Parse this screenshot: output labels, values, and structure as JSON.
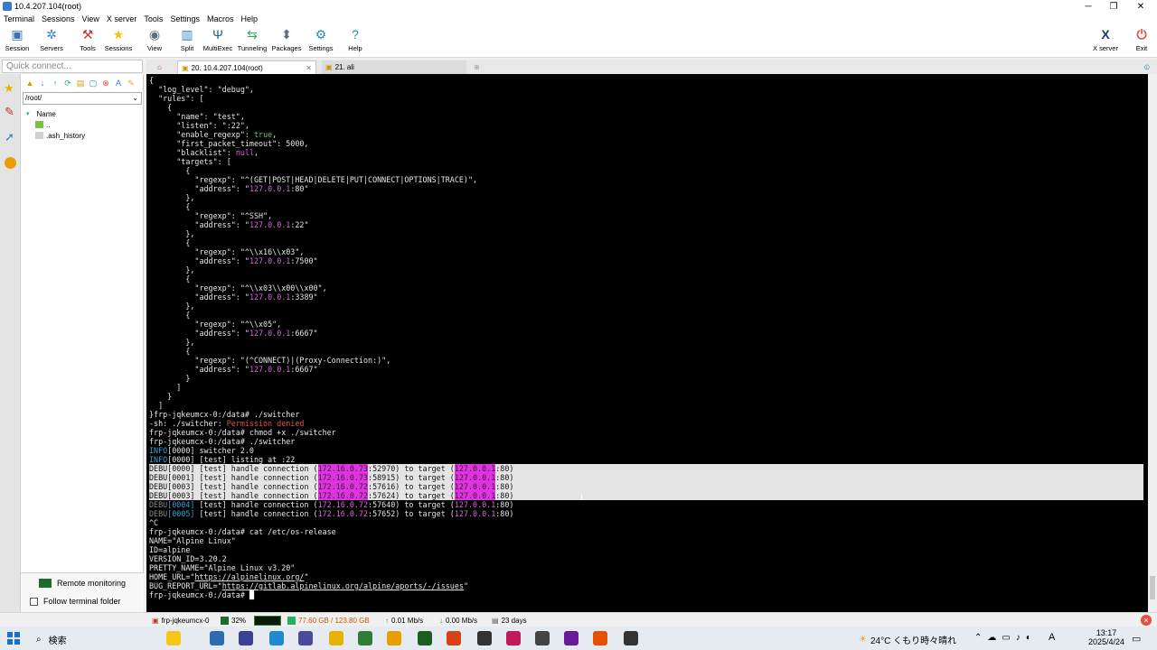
{
  "window": {
    "title": "10.4.207.104(root)",
    "controls": [
      "─",
      "❐",
      "✕"
    ]
  },
  "menu": [
    "Terminal",
    "Sessions",
    "View",
    "X server",
    "Tools",
    "Settings",
    "Macros",
    "Help"
  ],
  "toolbar": [
    {
      "label": "Session",
      "icon": "session-icon",
      "color": "#3b6fb6"
    },
    {
      "label": "Servers",
      "icon": "servers-icon",
      "color": "#2e86c1"
    },
    {
      "label": "Tools",
      "icon": "tools-icon",
      "color": "#c0392b"
    },
    {
      "label": "Sessions",
      "icon": "star-icon",
      "color": "#f1c40f"
    },
    {
      "label": "View",
      "icon": "view-icon",
      "color": "#5d6d7e"
    },
    {
      "label": "Split",
      "icon": "split-icon",
      "color": "#2e86c1"
    },
    {
      "label": "MultiExec",
      "icon": "multiexec-icon",
      "color": "#1f618d"
    },
    {
      "label": "Tunneling",
      "icon": "tunneling-icon",
      "color": "#27ae60"
    },
    {
      "label": "Packages",
      "icon": "packages-icon",
      "color": "#5d6d7e"
    },
    {
      "label": "Settings",
      "icon": "gear-icon",
      "color": "#2e86c1"
    },
    {
      "label": "Help",
      "icon": "help-icon",
      "color": "#2e86c1"
    }
  ],
  "toolbar_right": [
    {
      "label": "X server",
      "icon": "x-server-icon"
    },
    {
      "label": "Exit",
      "icon": "exit-icon"
    }
  ],
  "quick_connect": {
    "placeholder": "Quick connect..."
  },
  "tabs": [
    {
      "label": "20. 10.4.207.104(root)",
      "active": true
    },
    {
      "label": "21. ali",
      "active": false
    }
  ],
  "filepane": {
    "path": "/root/",
    "column": "Name",
    "items": [
      "..",
      ".ash_history"
    ],
    "remote_monitoring": "Remote monitoring",
    "follow_folder": "Follow terminal folder"
  },
  "terminal": {
    "lines": [
      [
        {
          "t": "{"
        }
      ],
      [
        {
          "t": "  \"log_level\": \"debug\","
        }
      ],
      [
        {
          "t": "  \"rules\": ["
        }
      ],
      [
        {
          "t": "    {"
        }
      ],
      [
        {
          "t": "      \"name\": \"test\","
        }
      ],
      [
        {
          "t": "      \"listen\": \":22\","
        }
      ],
      [
        {
          "t": "      \"enable_regexp\": "
        },
        {
          "t": "true",
          "c": "#7ec640"
        },
        {
          "t": ","
        }
      ],
      [
        {
          "t": "      \"first_packet_timeout\": 5000,"
        }
      ],
      [
        {
          "t": "      \"blacklist\": "
        },
        {
          "t": "null",
          "c": "#d56ad5"
        },
        {
          "t": ","
        }
      ],
      [
        {
          "t": "      \"targets\": ["
        }
      ],
      [
        {
          "t": "        {"
        }
      ],
      [
        {
          "t": "          \"regexp\": \"^(GET|POST|HEAD|DELETE|PUT|CONNECT|OPTIONS|TRACE)\","
        }
      ],
      [
        {
          "t": "          \"address\": \""
        },
        {
          "t": "127.0.0.1",
          "c": "#d56ad5"
        },
        {
          "t": ":80\""
        }
      ],
      [
        {
          "t": "        },"
        }
      ],
      [
        {
          "t": "        {"
        }
      ],
      [
        {
          "t": "          \"regexp\": \"^SSH\","
        }
      ],
      [
        {
          "t": "          \"address\": \""
        },
        {
          "t": "127.0.0.1",
          "c": "#d56ad5"
        },
        {
          "t": ":22\""
        }
      ],
      [
        {
          "t": "        },"
        }
      ],
      [
        {
          "t": "        {"
        }
      ],
      [
        {
          "t": "          \"regexp\": \"^\\\\x16\\\\x03\","
        }
      ],
      [
        {
          "t": "          \"address\": \""
        },
        {
          "t": "127.0.0.1",
          "c": "#d56ad5"
        },
        {
          "t": ":7500\""
        }
      ],
      [
        {
          "t": "        },"
        }
      ],
      [
        {
          "t": "        {"
        }
      ],
      [
        {
          "t": "          \"regexp\": \"^\\\\x03\\\\x00\\\\x00\","
        }
      ],
      [
        {
          "t": "          \"address\": \""
        },
        {
          "t": "127.0.0.1",
          "c": "#d56ad5"
        },
        {
          "t": ":3389\""
        }
      ],
      [
        {
          "t": "        },"
        }
      ],
      [
        {
          "t": "        {"
        }
      ],
      [
        {
          "t": "          \"regexp\": \"^\\\\x05\","
        }
      ],
      [
        {
          "t": "          \"address\": \""
        },
        {
          "t": "127.0.0.1",
          "c": "#d56ad5"
        },
        {
          "t": ":6667\""
        }
      ],
      [
        {
          "t": "        },"
        }
      ],
      [
        {
          "t": "        {"
        }
      ],
      [
        {
          "t": "          \"regexp\": \"(^CONNECT)|(Proxy-Connection:)\","
        }
      ],
      [
        {
          "t": "          \"address\": \""
        },
        {
          "t": "127.0.0.1",
          "c": "#d56ad5"
        },
        {
          "t": ":6667\""
        }
      ],
      [
        {
          "t": "        }"
        }
      ],
      [
        {
          "t": "      ]"
        }
      ],
      [
        {
          "t": "    }"
        }
      ],
      [
        {
          "t": "  ]"
        }
      ],
      [
        {
          "t": "}frp-jqkeumcx-0:/data# ./switcher"
        }
      ],
      [
        {
          "t": "-sh: ./switcher: "
        },
        {
          "t": "Permission denied",
          "c": "#e05050"
        }
      ],
      [
        {
          "t": "frp-jqkeumcx-0:/data# chmod +x ./switcher"
        }
      ],
      [
        {
          "t": "frp-jqkeumcx-0:/data# ./switcher"
        }
      ],
      [
        {
          "t": "INFO",
          "c": "#3aa0d8"
        },
        {
          "t": "[0000] switcher 2.0"
        }
      ],
      [
        {
          "t": "INFO",
          "c": "#3aa0d8"
        },
        {
          "t": "[0000] [test] listing at :22"
        }
      ],
      [
        {
          "t": "DEBU",
          "c": "#888888"
        },
        {
          "t": "[0000]",
          "c": "#3aa0d8"
        },
        {
          "t": " [test] handle connection ("
        },
        {
          "t": "172.16.0.73",
          "c": "#d56ad5"
        },
        {
          "t": ":52970) to target ("
        },
        {
          "t": "127.0.0.1",
          "c": "#d56ad5"
        },
        {
          "t": ":80)"
        }
      ],
      [
        {
          "t": "DEBU",
          "c": "#888888"
        },
        {
          "t": "[0001]",
          "c": "#3aa0d8"
        },
        {
          "t": " [test] handle connection ("
        },
        {
          "t": "172.16.0.73",
          "c": "#d56ad5"
        },
        {
          "t": ":58915) to target ("
        },
        {
          "t": "127.0.0.1",
          "c": "#d56ad5"
        },
        {
          "t": ":80)"
        }
      ],
      [
        {
          "t": "DEBU",
          "c": "#888888"
        },
        {
          "t": "[0003]",
          "c": "#3aa0d8"
        },
        {
          "t": " [test] handle connection ("
        },
        {
          "t": "172.16.0.72",
          "c": "#d56ad5"
        },
        {
          "t": ":57616) to target ("
        },
        {
          "t": "127.0.0.1",
          "c": "#d56ad5"
        },
        {
          "t": ":80)"
        }
      ],
      [
        {
          "t": "DEBU",
          "c": "#888888"
        },
        {
          "t": "[0003]",
          "c": "#3aa0d8"
        },
        {
          "t": " [test] handle connection ("
        },
        {
          "t": "172.16.0.72",
          "c": "#d56ad5"
        },
        {
          "t": ":57624) to target ("
        },
        {
          "t": "127.0.0.1",
          "c": "#d56ad5"
        },
        {
          "t": ":80)"
        }
      ],
      [
        {
          "t": "DEBU",
          "c": "#888888"
        },
        {
          "t": "[0004]",
          "c": "#3aa0d8"
        },
        {
          "t": " [test] handle connection ("
        },
        {
          "t": "172.16.0.72",
          "c": "#d56ad5"
        },
        {
          "t": ":57640) to target ("
        },
        {
          "t": "127.0.0.1",
          "c": "#d56ad5"
        },
        {
          "t": ":80)"
        }
      ],
      [
        {
          "t": "DEBU",
          "c": "#888888"
        },
        {
          "t": "[0005]",
          "c": "#3aa0d8"
        },
        {
          "t": " [test] handle connection ("
        },
        {
          "t": "172.16.0.72",
          "c": "#d56ad5"
        },
        {
          "t": ":57652) to target ("
        },
        {
          "t": "127.0.0.1",
          "c": "#d56ad5"
        },
        {
          "t": ":80)"
        }
      ],
      [
        {
          "t": "^C"
        }
      ],
      [
        {
          "t": "frp-jqkeumcx-0:/data# cat /etc/os-release"
        }
      ],
      [
        {
          "t": "NAME=\"Alpine Linux\""
        }
      ],
      [
        {
          "t": "ID=alpine"
        }
      ],
      [
        {
          "t": "VERSION_ID=3.20.2"
        }
      ],
      [
        {
          "t": "PRETTY_NAME=\"Alpine Linux v3.20\""
        }
      ],
      [
        {
          "t": "HOME_URL=\""
        },
        {
          "t": "https://alpinelinux.org/",
          "u": true
        },
        {
          "t": "\""
        }
      ],
      [
        {
          "t": "BUG_REPORT_URL=\""
        },
        {
          "t": "https://gitlab.alpinelinux.org/alpine/aports/-/issues",
          "u": true
        },
        {
          "t": "\""
        }
      ],
      [
        {
          "t": "frp-jqkeumcx-0:/data# "
        },
        {
          "t": "█",
          "c": "#ffffff"
        }
      ]
    ]
  },
  "statusbar": {
    "host": "frp-jqkeumcx-0",
    "cpu": "32%",
    "disk": "77.60 GB / 123.80 GB",
    "upload": "0.01 Mb/s",
    "download": "0.00 Mb/s",
    "uptime": "23 days"
  },
  "taskbar": {
    "search": "検索",
    "weather": "24°C くもり時々晴れ",
    "time": "13:17",
    "date": "2025/4/24",
    "ime": "A"
  }
}
